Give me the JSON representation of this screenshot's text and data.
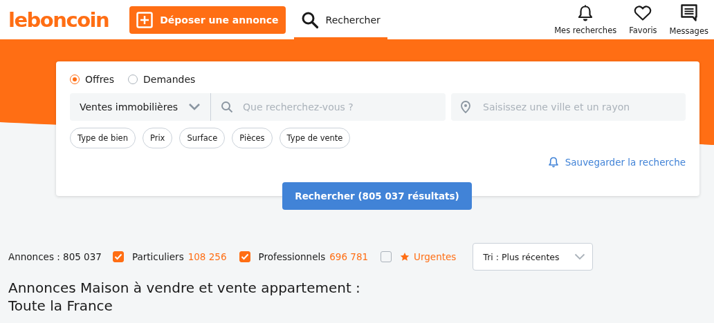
{
  "header": {
    "logo": "leboncoin",
    "post_button": "Déposer une annonce",
    "search_tab": {
      "label": "Rechercher",
      "selected": true
    },
    "nav": [
      {
        "kind": "bell",
        "label": "Mes recherches"
      },
      {
        "kind": "heart",
        "label": "Favoris"
      },
      {
        "kind": "message",
        "label": "Messages"
      }
    ]
  },
  "search": {
    "ad_types": [
      {
        "label": "Offres",
        "selected": true
      },
      {
        "label": "Demandes",
        "selected": false
      }
    ],
    "category": "Ventes immobilières",
    "query_placeholder": "Que recherchez-vous ?",
    "location_placeholder": "Saisissez une ville et un rayon",
    "filters": [
      "Type de bien",
      "Prix",
      "Surface",
      "Pièces",
      "Type de vente"
    ],
    "save_link": "Sauvegarder la recherche",
    "submit": "Rechercher (805 037 résultats)"
  },
  "results": {
    "total": "Annonces : 805 037",
    "options": [
      {
        "kind": "plain",
        "label": "Particuliers",
        "count": "108 256",
        "checked": true
      },
      {
        "kind": "plain",
        "label": "Professionnels",
        "count": "696 781",
        "checked": true
      },
      {
        "kind": "star",
        "label": "Urgentes",
        "checked": false
      }
    ],
    "sort": "Tri : Plus récentes",
    "title": [
      "Annonces Maison à vendre et vente appartement :",
      "Toute la France"
    ]
  }
}
